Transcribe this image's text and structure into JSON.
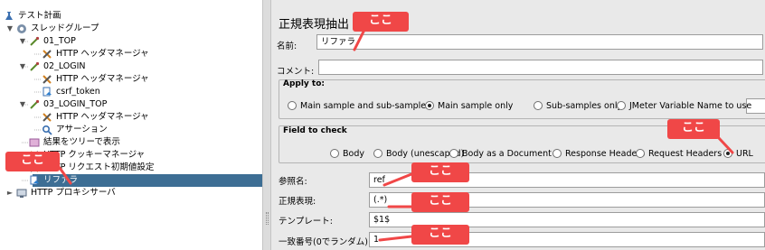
{
  "tree": {
    "items": [
      {
        "label": "テスト計画",
        "icon": "flask-icon"
      },
      {
        "label": "スレッドグループ",
        "icon": "gear-icon"
      },
      {
        "label": "01_TOP",
        "icon": "pipette-icon"
      },
      {
        "label": "HTTP ヘッダマネージャ",
        "icon": "tools-icon"
      },
      {
        "label": "02_LOGIN",
        "icon": "pipette-icon"
      },
      {
        "label": "HTTP ヘッダマネージャ",
        "icon": "tools-icon"
      },
      {
        "label": "csrf_token",
        "icon": "extractor-icon"
      },
      {
        "label": "03_LOGIN_TOP",
        "icon": "pipette-icon"
      },
      {
        "label": "HTTP ヘッダマネージャ",
        "icon": "tools-icon"
      },
      {
        "label": "アサーション",
        "icon": "magnifier-icon"
      },
      {
        "label": "結果をツリーで表示",
        "icon": "listener-icon"
      },
      {
        "label": "HTTP クッキーマネージャ",
        "icon": "tools-icon"
      },
      {
        "label": "HTTP リクエスト初期値設定",
        "icon": "tools-icon"
      },
      {
        "label": "リファラ",
        "icon": "extractor-icon"
      },
      {
        "label": "HTTP プロキシサーバ",
        "icon": "proxy-icon"
      }
    ]
  },
  "panel": {
    "title": "正規表現抽出",
    "name_label": "名前:",
    "name_value": "リファラ",
    "comment_label": "コメント:",
    "comment_value": "",
    "apply_to": {
      "title": "Apply to:",
      "options": [
        "Main sample and sub-samples",
        "Main sample only",
        "Sub-samples only",
        "JMeter Variable Name to use"
      ],
      "selected": "Main sample only",
      "variable_value": ""
    },
    "field_to_check": {
      "title": "Field to check",
      "options": [
        "Body",
        "Body (unescaped)",
        "Body as a Document",
        "Response Headers",
        "Request Headers",
        "URL"
      ],
      "selected": "URL"
    },
    "ref_label": "参照名:",
    "ref_value": "ref",
    "regex_label": "正規表現:",
    "regex_value": "(.*)",
    "template_label": "テンプレート:",
    "template_value": "$1$",
    "match_label": "一致番号(0でランダム):",
    "match_value": "1"
  },
  "annotations": {
    "text": "ここ",
    "color": "#f04747"
  }
}
